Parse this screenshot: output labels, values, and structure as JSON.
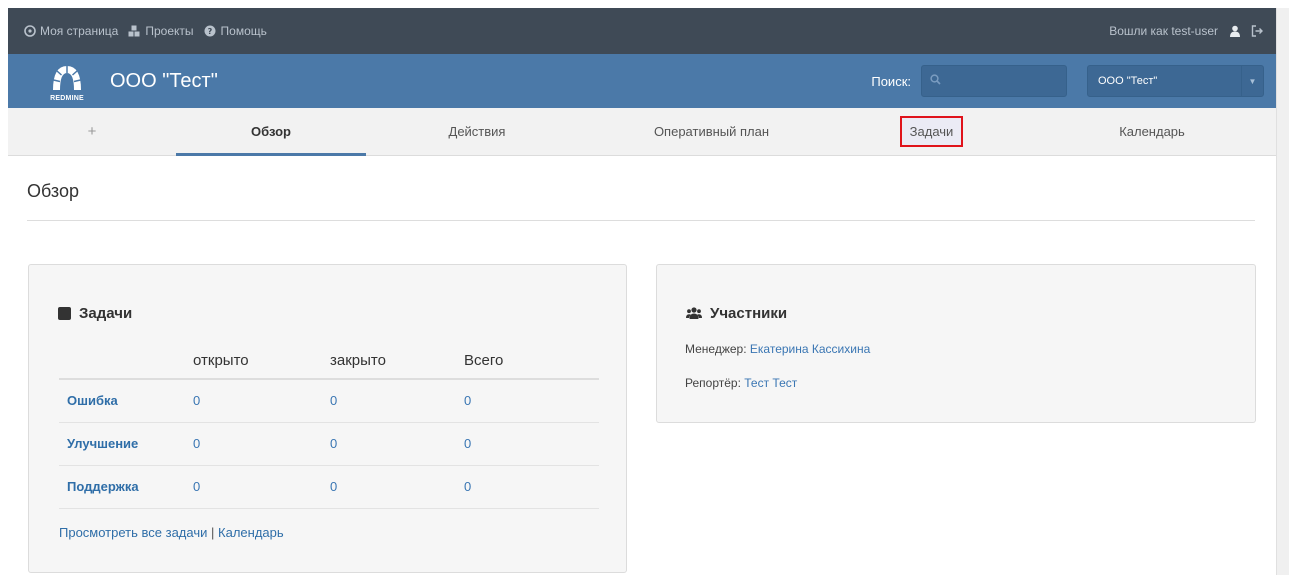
{
  "topbar": {
    "my_page": "Моя страница",
    "projects": "Проекты",
    "help": "Помощь",
    "logged_in": "Вошли как test-user"
  },
  "header": {
    "logo_text": "REDMINE",
    "project_title": "ООО \"Тест\"",
    "search_label": "Поиск:",
    "search_value": "",
    "project_select": "ООО \"Тест\""
  },
  "tabs": [
    {
      "label": "+"
    },
    {
      "label": "Обзор"
    },
    {
      "label": "Действия"
    },
    {
      "label": "Оперативный план"
    },
    {
      "label": "Задачи"
    },
    {
      "label": "Календарь"
    }
  ],
  "page_title": "Обзор",
  "issues_box": {
    "title": "Задачи",
    "columns": [
      "",
      "открыто",
      "закрыто",
      "Всего"
    ],
    "rows": [
      {
        "tracker": "Ошибка",
        "open": "0",
        "closed": "0",
        "total": "0"
      },
      {
        "tracker": "Улучшение",
        "open": "0",
        "closed": "0",
        "total": "0"
      },
      {
        "tracker": "Поддержка",
        "open": "0",
        "closed": "0",
        "total": "0"
      }
    ],
    "view_all": "Просмотреть все задачи",
    "separator": "|",
    "calendar": "Календарь"
  },
  "members_box": {
    "title": "Участники",
    "manager_label": "Менеджер:",
    "manager_name": "Екатерина Кассихина",
    "reporter_label": "Репортёр:",
    "reporter_name": "Тест Тест"
  },
  "colors": {
    "topbar": "#3f4a56",
    "header": "#4b79a8",
    "highlight_border": "#e0131b",
    "link": "#2f6ea8"
  }
}
